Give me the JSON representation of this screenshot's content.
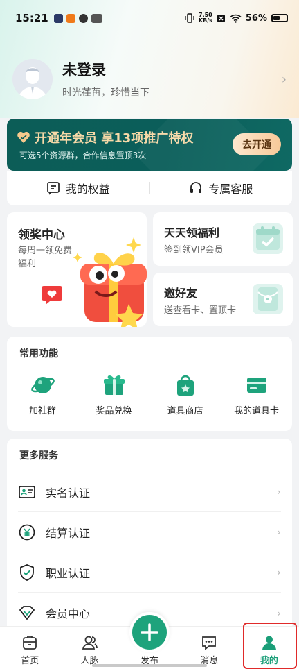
{
  "status_bar": {
    "time": "15:21",
    "net_speed_value": "7.50",
    "net_speed_unit": "KB/s",
    "battery": "56%"
  },
  "profile": {
    "name": "未登录",
    "motto": "时光荏苒，珍惜当下"
  },
  "vip_banner": {
    "title": "开通年会员 享13项推广特权",
    "subtitle": "可选5个资源群，合作信息置顶3次",
    "button": "去开通",
    "accent": "#0c5d57"
  },
  "rights_row": [
    {
      "label": "我的权益",
      "icon": "benefits-icon"
    },
    {
      "label": "专属客服",
      "icon": "headset-icon"
    }
  ],
  "reward_center": {
    "title": "领奖中心",
    "subtitle": "每周一领免费福利"
  },
  "daily_benefit": {
    "title": "天天领福利",
    "subtitle": "签到领VIP会员"
  },
  "invite": {
    "title": "邀好友",
    "subtitle": "送查看卡、置顶卡"
  },
  "common_functions": {
    "title": "常用功能",
    "items": [
      {
        "label": "加社群",
        "icon": "planet-icon"
      },
      {
        "label": "奖品兑换",
        "icon": "gift-icon"
      },
      {
        "label": "道具商店",
        "icon": "shop-bag-icon"
      },
      {
        "label": "我的道具卡",
        "icon": "card-icon"
      }
    ]
  },
  "more_services": {
    "title": "更多服务",
    "items": [
      {
        "label": "实名认证",
        "icon": "id-card-icon"
      },
      {
        "label": "结算认证",
        "icon": "yuan-icon"
      },
      {
        "label": "职业认证",
        "icon": "shield-check-icon"
      },
      {
        "label": "会员中心",
        "icon": "diamond-icon"
      }
    ]
  },
  "tabbar": {
    "items": [
      {
        "label": "首页",
        "icon": "home-icon"
      },
      {
        "label": "人脉",
        "icon": "contacts-icon"
      },
      {
        "label": "发布",
        "icon": "plus-icon"
      },
      {
        "label": "消息",
        "icon": "message-icon"
      },
      {
        "label": "我的",
        "icon": "user-icon"
      }
    ],
    "active": "我的",
    "active_color": "#1a9e78"
  }
}
